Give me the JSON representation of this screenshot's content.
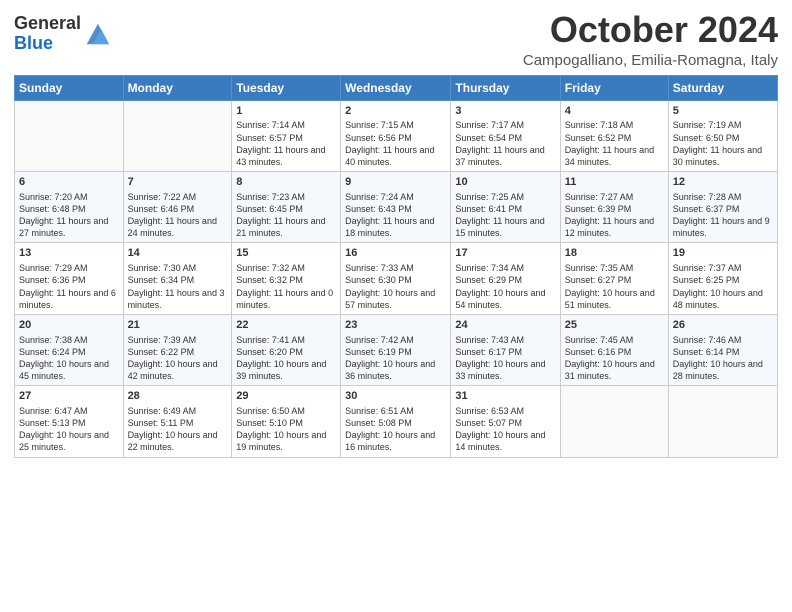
{
  "header": {
    "logo_general": "General",
    "logo_blue": "Blue",
    "month": "October 2024",
    "location": "Campogalliano, Emilia-Romagna, Italy"
  },
  "weekdays": [
    "Sunday",
    "Monday",
    "Tuesday",
    "Wednesday",
    "Thursday",
    "Friday",
    "Saturday"
  ],
  "weeks": [
    [
      {
        "day": "",
        "sunrise": "",
        "sunset": "",
        "daylight": ""
      },
      {
        "day": "",
        "sunrise": "",
        "sunset": "",
        "daylight": ""
      },
      {
        "day": "1",
        "sunrise": "Sunrise: 7:14 AM",
        "sunset": "Sunset: 6:57 PM",
        "daylight": "Daylight: 11 hours and 43 minutes."
      },
      {
        "day": "2",
        "sunrise": "Sunrise: 7:15 AM",
        "sunset": "Sunset: 6:56 PM",
        "daylight": "Daylight: 11 hours and 40 minutes."
      },
      {
        "day": "3",
        "sunrise": "Sunrise: 7:17 AM",
        "sunset": "Sunset: 6:54 PM",
        "daylight": "Daylight: 11 hours and 37 minutes."
      },
      {
        "day": "4",
        "sunrise": "Sunrise: 7:18 AM",
        "sunset": "Sunset: 6:52 PM",
        "daylight": "Daylight: 11 hours and 34 minutes."
      },
      {
        "day": "5",
        "sunrise": "Sunrise: 7:19 AM",
        "sunset": "Sunset: 6:50 PM",
        "daylight": "Daylight: 11 hours and 30 minutes."
      }
    ],
    [
      {
        "day": "6",
        "sunrise": "Sunrise: 7:20 AM",
        "sunset": "Sunset: 6:48 PM",
        "daylight": "Daylight: 11 hours and 27 minutes."
      },
      {
        "day": "7",
        "sunrise": "Sunrise: 7:22 AM",
        "sunset": "Sunset: 6:46 PM",
        "daylight": "Daylight: 11 hours and 24 minutes."
      },
      {
        "day": "8",
        "sunrise": "Sunrise: 7:23 AM",
        "sunset": "Sunset: 6:45 PM",
        "daylight": "Daylight: 11 hours and 21 minutes."
      },
      {
        "day": "9",
        "sunrise": "Sunrise: 7:24 AM",
        "sunset": "Sunset: 6:43 PM",
        "daylight": "Daylight: 11 hours and 18 minutes."
      },
      {
        "day": "10",
        "sunrise": "Sunrise: 7:25 AM",
        "sunset": "Sunset: 6:41 PM",
        "daylight": "Daylight: 11 hours and 15 minutes."
      },
      {
        "day": "11",
        "sunrise": "Sunrise: 7:27 AM",
        "sunset": "Sunset: 6:39 PM",
        "daylight": "Daylight: 11 hours and 12 minutes."
      },
      {
        "day": "12",
        "sunrise": "Sunrise: 7:28 AM",
        "sunset": "Sunset: 6:37 PM",
        "daylight": "Daylight: 11 hours and 9 minutes."
      }
    ],
    [
      {
        "day": "13",
        "sunrise": "Sunrise: 7:29 AM",
        "sunset": "Sunset: 6:36 PM",
        "daylight": "Daylight: 11 hours and 6 minutes."
      },
      {
        "day": "14",
        "sunrise": "Sunrise: 7:30 AM",
        "sunset": "Sunset: 6:34 PM",
        "daylight": "Daylight: 11 hours and 3 minutes."
      },
      {
        "day": "15",
        "sunrise": "Sunrise: 7:32 AM",
        "sunset": "Sunset: 6:32 PM",
        "daylight": "Daylight: 11 hours and 0 minutes."
      },
      {
        "day": "16",
        "sunrise": "Sunrise: 7:33 AM",
        "sunset": "Sunset: 6:30 PM",
        "daylight": "Daylight: 10 hours and 57 minutes."
      },
      {
        "day": "17",
        "sunrise": "Sunrise: 7:34 AM",
        "sunset": "Sunset: 6:29 PM",
        "daylight": "Daylight: 10 hours and 54 minutes."
      },
      {
        "day": "18",
        "sunrise": "Sunrise: 7:35 AM",
        "sunset": "Sunset: 6:27 PM",
        "daylight": "Daylight: 10 hours and 51 minutes."
      },
      {
        "day": "19",
        "sunrise": "Sunrise: 7:37 AM",
        "sunset": "Sunset: 6:25 PM",
        "daylight": "Daylight: 10 hours and 48 minutes."
      }
    ],
    [
      {
        "day": "20",
        "sunrise": "Sunrise: 7:38 AM",
        "sunset": "Sunset: 6:24 PM",
        "daylight": "Daylight: 10 hours and 45 minutes."
      },
      {
        "day": "21",
        "sunrise": "Sunrise: 7:39 AM",
        "sunset": "Sunset: 6:22 PM",
        "daylight": "Daylight: 10 hours and 42 minutes."
      },
      {
        "day": "22",
        "sunrise": "Sunrise: 7:41 AM",
        "sunset": "Sunset: 6:20 PM",
        "daylight": "Daylight: 10 hours and 39 minutes."
      },
      {
        "day": "23",
        "sunrise": "Sunrise: 7:42 AM",
        "sunset": "Sunset: 6:19 PM",
        "daylight": "Daylight: 10 hours and 36 minutes."
      },
      {
        "day": "24",
        "sunrise": "Sunrise: 7:43 AM",
        "sunset": "Sunset: 6:17 PM",
        "daylight": "Daylight: 10 hours and 33 minutes."
      },
      {
        "day": "25",
        "sunrise": "Sunrise: 7:45 AM",
        "sunset": "Sunset: 6:16 PM",
        "daylight": "Daylight: 10 hours and 31 minutes."
      },
      {
        "day": "26",
        "sunrise": "Sunrise: 7:46 AM",
        "sunset": "Sunset: 6:14 PM",
        "daylight": "Daylight: 10 hours and 28 minutes."
      }
    ],
    [
      {
        "day": "27",
        "sunrise": "Sunrise: 6:47 AM",
        "sunset": "Sunset: 5:13 PM",
        "daylight": "Daylight: 10 hours and 25 minutes."
      },
      {
        "day": "28",
        "sunrise": "Sunrise: 6:49 AM",
        "sunset": "Sunset: 5:11 PM",
        "daylight": "Daylight: 10 hours and 22 minutes."
      },
      {
        "day": "29",
        "sunrise": "Sunrise: 6:50 AM",
        "sunset": "Sunset: 5:10 PM",
        "daylight": "Daylight: 10 hours and 19 minutes."
      },
      {
        "day": "30",
        "sunrise": "Sunrise: 6:51 AM",
        "sunset": "Sunset: 5:08 PM",
        "daylight": "Daylight: 10 hours and 16 minutes."
      },
      {
        "day": "31",
        "sunrise": "Sunrise: 6:53 AM",
        "sunset": "Sunset: 5:07 PM",
        "daylight": "Daylight: 10 hours and 14 minutes."
      },
      {
        "day": "",
        "sunrise": "",
        "sunset": "",
        "daylight": ""
      },
      {
        "day": "",
        "sunrise": "",
        "sunset": "",
        "daylight": ""
      }
    ]
  ]
}
